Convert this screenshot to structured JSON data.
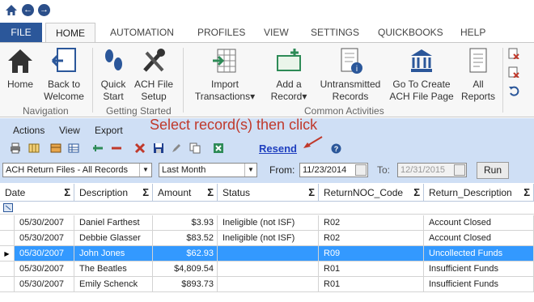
{
  "ribbon": {
    "tabs": [
      {
        "label": "FILE"
      },
      {
        "label": "HOME"
      },
      {
        "label": "AUTOMATION"
      },
      {
        "label": "PROFILES"
      },
      {
        "label": "VIEW"
      },
      {
        "label": "SETTINGS"
      },
      {
        "label": "QUICKBOOKS"
      },
      {
        "label": "HELP"
      }
    ],
    "buttons": {
      "home": "Home",
      "back_to_welcome": "Back to Welcome",
      "quick_start": "Quick Start",
      "ach_file_setup": "ACH File Setup",
      "import_transactions": "Import Transactions",
      "add_record": "Add a Record",
      "untransmitted_records": "Untransmitted Records",
      "go_to_create": "Go To Create ACH File Page",
      "all_reports": "All Reports"
    },
    "groups": {
      "navigation": "Navigation",
      "getting_started": "Getting Started",
      "common_activities": "Common Activities"
    }
  },
  "menus": {
    "actions": "Actions",
    "view": "View",
    "export": "Export"
  },
  "hint": "Select record(s) then click",
  "resend_label": "Resend",
  "filters": {
    "file_filter": "ACH Return Files - All Records",
    "period": "Last Month",
    "from_label": "From:",
    "from_date": "11/23/2014",
    "to_label": "To:",
    "to_date": "12/31/2015",
    "run_label": "Run"
  },
  "grid": {
    "columns": [
      "Date",
      "Description",
      "Amount",
      "Status",
      "ReturnNOC_Code",
      "Return_Description"
    ],
    "rows": [
      {
        "date": "05/30/2007",
        "description": "Daniel Farthest",
        "amount": "$3.93",
        "status": "Ineligible (not ISF)",
        "code": "R02",
        "return_desc": "Account Closed"
      },
      {
        "date": "05/30/2007",
        "description": "Debbie Glasser",
        "amount": "$83.52",
        "status": "Ineligible (not ISF)",
        "code": "R02",
        "return_desc": "Account Closed"
      },
      {
        "date": "05/30/2007",
        "description": "John Jones",
        "amount": "$62.93",
        "status": "",
        "code": "R09",
        "return_desc": "Uncollected Funds"
      },
      {
        "date": "05/30/2007",
        "description": "The Beatles",
        "amount": "$4,809.54",
        "status": "",
        "code": "R01",
        "return_desc": "Insufficient Funds"
      },
      {
        "date": "05/30/2007",
        "description": "Emily Schenck",
        "amount": "$893.73",
        "status": "",
        "code": "R01",
        "return_desc": "Insufficient Funds"
      }
    ],
    "selected_row": 2
  },
  "colors": {
    "accent": "#2b579a",
    "panel": "#cfdff5",
    "selection": "#3399ff",
    "hint": "#c0392b"
  }
}
